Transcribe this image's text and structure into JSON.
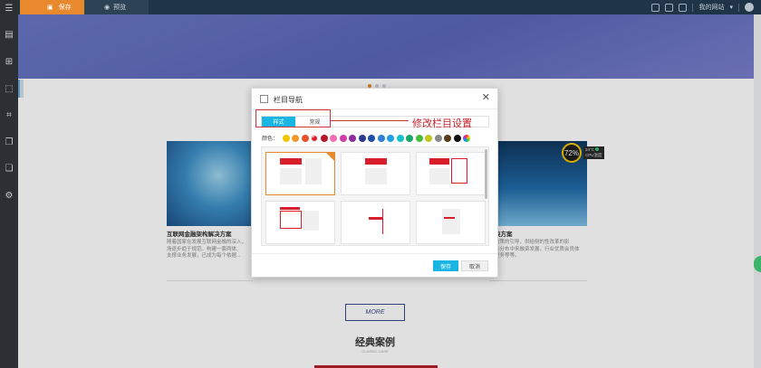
{
  "topbar": {
    "save_tab": "保存",
    "preview_tab": "预览",
    "my_site": "我的网站"
  },
  "page": {
    "card1": {
      "title": "互联网金融架构解决方案",
      "desc": "随着国家在发展互联网金融的深入，\n场逐步趋于规范。构建一套两体、\n支撑业务发展，已成为每个依据..."
    },
    "card3": {
      "title": "决方案",
      "desc": "政策的引导，供给侧的性改革的影\n务分布中来融资发展，行业优质会员体\n更务等等。"
    },
    "more_button": "MORE",
    "section_title": "经典案例",
    "section_subtitle": "CLASSIC CASE"
  },
  "cpu": {
    "percent": "72%",
    "temp": "24°C",
    "label": "CPU温度"
  },
  "modal": {
    "title": "栏目导航",
    "tabs": [
      {
        "label": "样式"
      },
      {
        "label": "常规"
      }
    ],
    "color_label": "颜色：",
    "colors": [
      "#f5c400",
      "#f29a2e",
      "#e8532a",
      "#d81e2a",
      "#b3172a",
      "#f06fb4",
      "#d23ca8",
      "#8e2d9c",
      "#2d3a8c",
      "#1f4ea8",
      "#2f7fd6",
      "#1ea0e3",
      "#18c0c8",
      "#17a86a",
      "#4bbd3b",
      "#c2c91d",
      "#8a8a8a",
      "#5a3a1a",
      "#111111"
    ],
    "selected_color_index": 3,
    "save_button": "保存",
    "cancel_button": "取消"
  },
  "annotation": {
    "text": "修改栏目设置"
  }
}
